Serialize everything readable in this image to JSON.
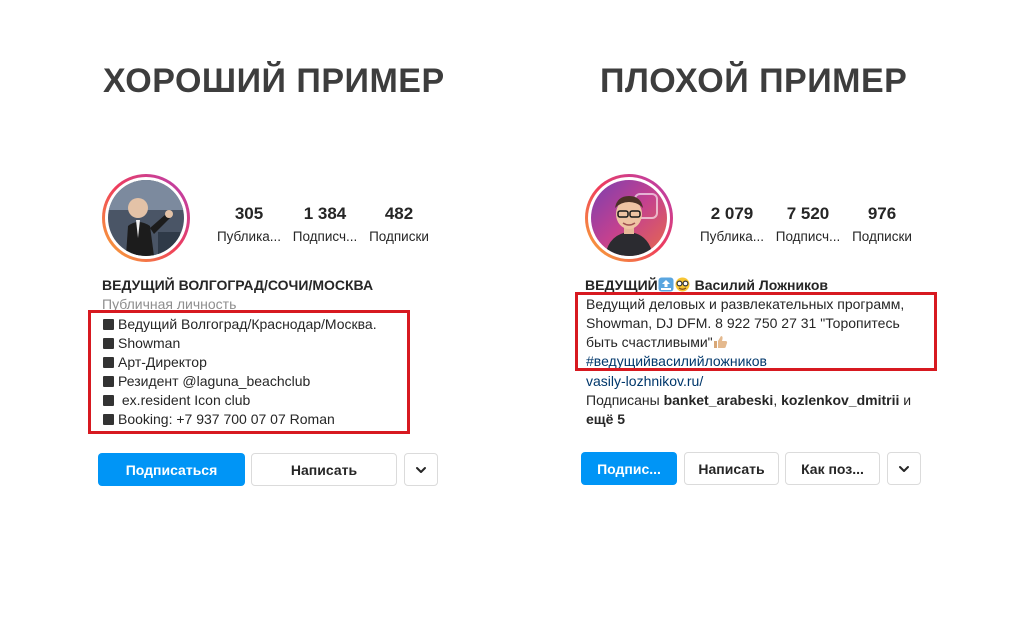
{
  "good": {
    "heading": "ХОРОШИЙ ПРИМЕР",
    "stats": [
      {
        "value": "305",
        "label": "Публика..."
      },
      {
        "value": "1 384",
        "label": "Подписч..."
      },
      {
        "value": "482",
        "label": "Подписки"
      }
    ],
    "name": "ВЕДУЩИЙ ВОЛГОГРАД/СОЧИ/МОСКВА",
    "category": "Публичная личность",
    "bio": [
      "Ведущий Волгоград/Краснодар/Москва.",
      "Showman",
      "Арт-Директор",
      "Резидент @laguna_beachclub",
      " ex.resident Icon club",
      "Booking: +7 937 700 07 07 Roman"
    ],
    "buttons": {
      "follow": "Подписаться",
      "message": "Написать"
    }
  },
  "bad": {
    "heading": "ПЛОХОЙ ПРИМЕР",
    "stats": [
      {
        "value": "2 079",
        "label": "Публика..."
      },
      {
        "value": "7 520",
        "label": "Подписч..."
      },
      {
        "value": "976",
        "label": "Подписки"
      }
    ],
    "name_prefix": "ВЕДУЩИЙ",
    "name_suffix": "Василий Ложников",
    "bio": [
      "Ведущий деловых и развлекательных программ,",
      "Showman, DJ DFM. 8 922 750 27 31 \"Торопитесь",
      "быть счастливыми\""
    ],
    "hashtag": "#ведущийвасилийложников",
    "website": "vasily-lozhnikov.ru/",
    "followed_prefix": "Подписаны ",
    "followed_user1": "banket_arabeski",
    "followed_comma": ", ",
    "followed_user2": "kozlenkov_dmitrii",
    "followed_and": " и",
    "followed_more": "ещё 5",
    "buttons": {
      "follow": "Подпис...",
      "message": "Написать",
      "contact": "Как поз..."
    }
  },
  "icons": {
    "dropdown": "chevron-down-icon",
    "bullet": "black-square-icon",
    "emoji_top": "top-arrow-icon",
    "emoji_nerd": "nerd-face-icon",
    "emoji_thumb": "thumbs-up-icon"
  }
}
